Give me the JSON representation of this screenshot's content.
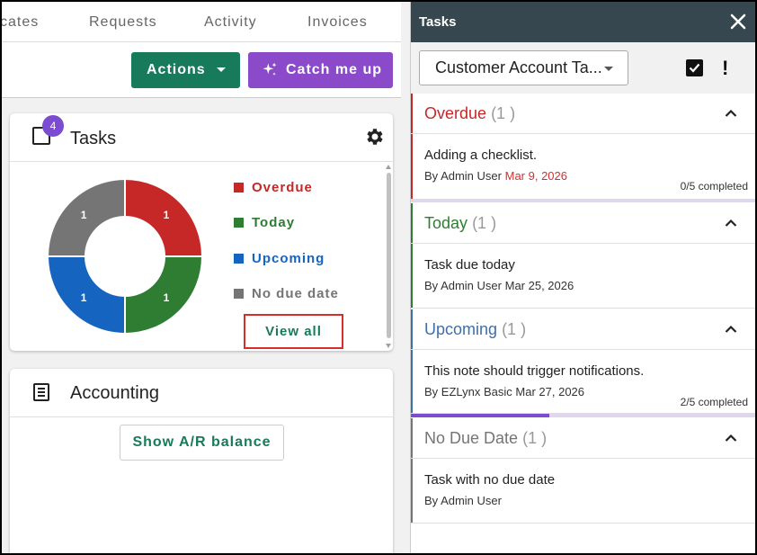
{
  "tabs": [
    {
      "label": "cates"
    },
    {
      "label": "Requests"
    },
    {
      "label": "Activity"
    },
    {
      "label": "Invoices"
    }
  ],
  "toolbar": {
    "actions_label": "Actions",
    "catch_label": "Catch me up"
  },
  "tasks_card": {
    "title": "Tasks",
    "badge": "4",
    "legend": [
      {
        "label": "Overdue",
        "color": "#c62828"
      },
      {
        "label": "Today",
        "color": "#2e7d32"
      },
      {
        "label": "Upcoming",
        "color": "#1565c0"
      },
      {
        "label": "No due date",
        "color": "#757575"
      }
    ],
    "view_all_label": "View all"
  },
  "chart_data": {
    "type": "pie",
    "donut": true,
    "categories": [
      "Overdue",
      "Today",
      "Upcoming",
      "No due date"
    ],
    "values": [
      1,
      1,
      1,
      1
    ],
    "colors": [
      "#c62828",
      "#2e7d32",
      "#1565c0",
      "#757575"
    ],
    "data_labels": [
      "1",
      "1",
      "1",
      "1"
    ],
    "legend_position": "right"
  },
  "accounting_card": {
    "title": "Accounting",
    "ar_button_label": "Show A/R balance"
  },
  "panel": {
    "title": "Tasks",
    "filter_value": "Customer Account Ta..."
  },
  "groups": [
    {
      "label": "Overdue",
      "count": "(1 )",
      "color": "#c62828",
      "task": {
        "title": "Adding a checklist.",
        "by": "By Admin User",
        "date": "Mar 9, 2026",
        "progress": "0/5 completed",
        "completed_fraction": 0.0
      }
    },
    {
      "label": "Today",
      "count": "(1 )",
      "color": "#2e7d32",
      "task": {
        "title": "Task due today",
        "by": "By Admin User",
        "date": "Mar 25, 2026"
      }
    },
    {
      "label": "Upcoming",
      "count": "(1 )",
      "color": "#3f6fa8",
      "task": {
        "title": "This note should trigger notifications.",
        "by": "By EZLynx Basic",
        "date": "Mar 27, 2026",
        "progress": "2/5 completed",
        "completed_fraction": 0.4
      }
    },
    {
      "label": "No Due Date",
      "count": "(1 )",
      "color": "#757575",
      "task": {
        "title": "Task with no due date",
        "by": "By Admin User"
      }
    }
  ]
}
